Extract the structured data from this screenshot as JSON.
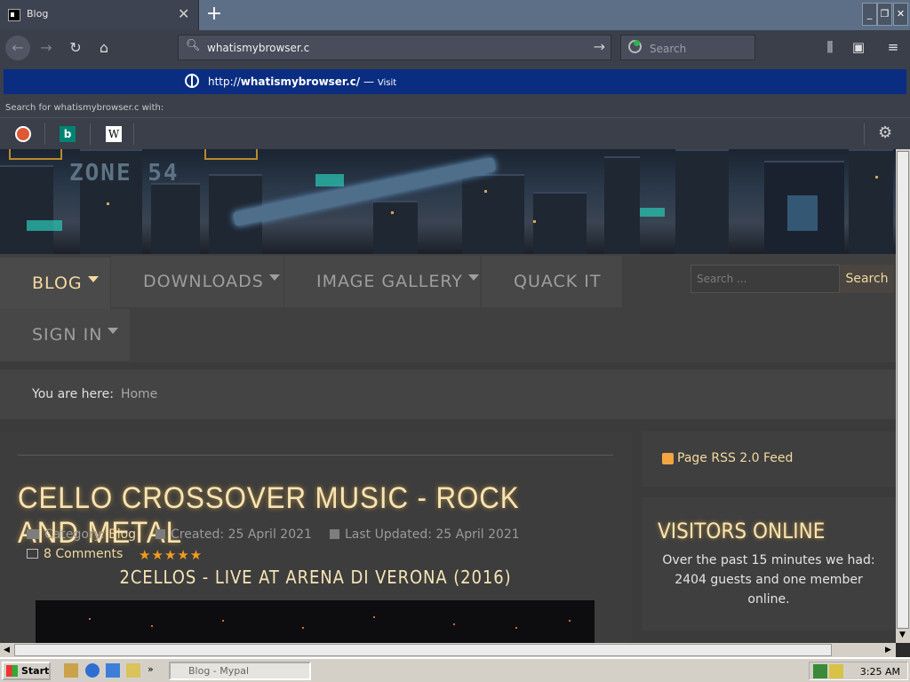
{
  "browser": {
    "tab_title": "Blog",
    "url_typed": "whatismybrowser.c",
    "search_placeholder": "Search",
    "suggestion_prefix": "http://",
    "suggestion_host": "whatismybrowser.c/",
    "suggestion_sep": " — ",
    "suggestion_action": "Visit",
    "search_with": "Search for whatismybrowser.c with:"
  },
  "site": {
    "logo_text": "ZONE 54",
    "nav": [
      {
        "label": "BLOG"
      },
      {
        "label": "DOWNLOADS"
      },
      {
        "label": "IMAGE GALLERY"
      },
      {
        "label": "QUACK IT"
      },
      {
        "label": "SIGN IN"
      }
    ],
    "search_placeholder": "Search ...",
    "search_button": "Search",
    "breadcrumb_label": "You are here:",
    "breadcrumb_home": "Home"
  },
  "article": {
    "title": "CELLO CROSSOVER MUSIC - ROCK AND METAL",
    "category_label": "Category:",
    "category": "Blog",
    "created": "Created: 25 April 2021",
    "updated": "Last Updated: 25 April 2021",
    "comments": "8 Comments",
    "stars": "★★★★★",
    "video_title": "2CELLOS - LIVE AT ARENA DI VERONA (2016)"
  },
  "sidebar": {
    "rss": "Page RSS 2.0 Feed",
    "visitors_title": "VISITORS ONLINE",
    "visitors_text": "Over the past 15 minutes we had: 2404 guests and one member online."
  },
  "taskbar": {
    "start": "Start",
    "task": "Blog - Mypal",
    "clock": "3:25 AM"
  }
}
